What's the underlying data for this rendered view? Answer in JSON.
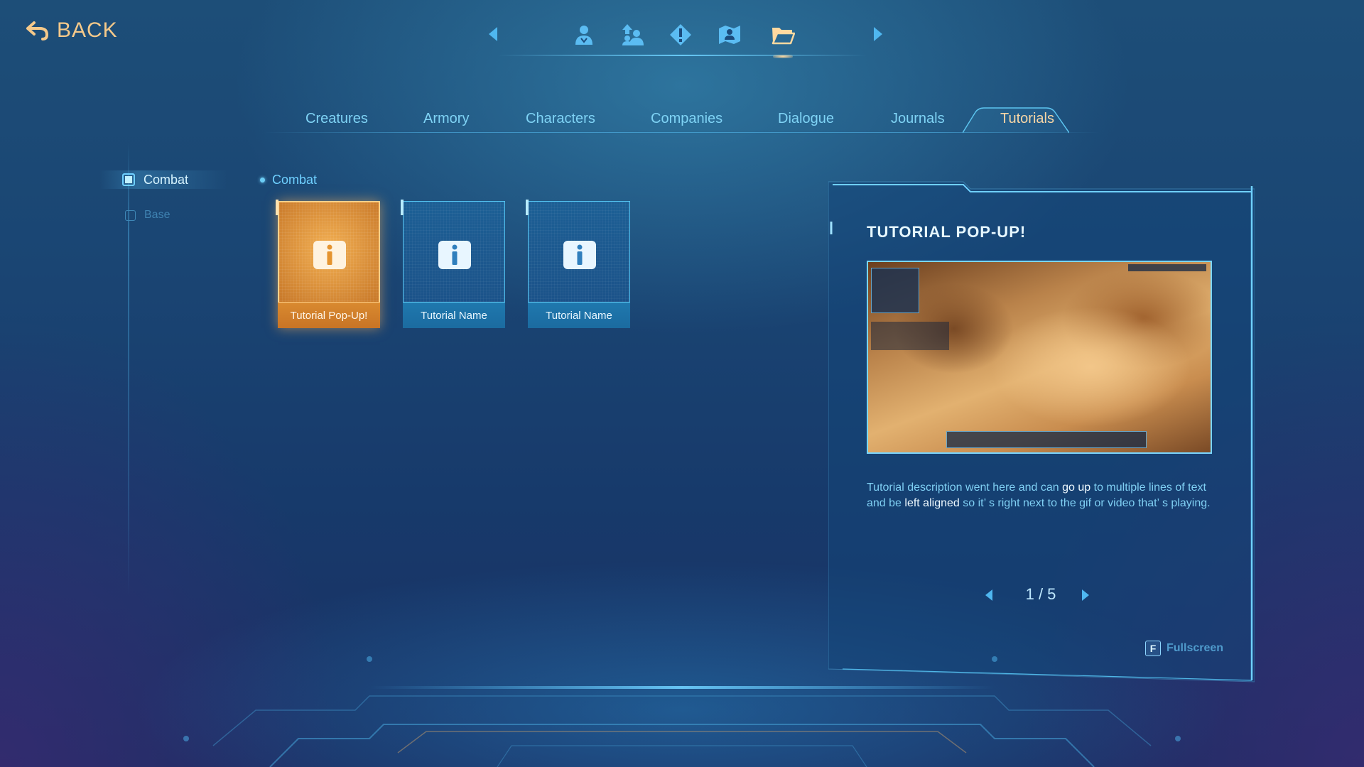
{
  "top_bar": {
    "back_label": "BACK",
    "nav_icons": [
      {
        "name": "character-icon",
        "active": false
      },
      {
        "name": "party-icon",
        "active": false
      },
      {
        "name": "alert-icon",
        "active": false
      },
      {
        "name": "map-icon",
        "active": false
      },
      {
        "name": "folder-icon",
        "active": true
      }
    ]
  },
  "tabs": [
    {
      "label": "Creatures",
      "active": false
    },
    {
      "label": "Armory",
      "active": false
    },
    {
      "label": "Characters",
      "active": false
    },
    {
      "label": "Companies",
      "active": false
    },
    {
      "label": "Dialogue",
      "active": false
    },
    {
      "label": "Journals",
      "active": false
    },
    {
      "label": "Tutorials",
      "active": true
    }
  ],
  "sidebar": {
    "items": [
      {
        "label": "Combat",
        "active": true
      },
      {
        "label": "Base",
        "active": false
      }
    ]
  },
  "category": {
    "label": "Combat"
  },
  "cards": [
    {
      "label": "Tutorial Pop-Up!",
      "selected": true
    },
    {
      "label": "Tutorial Name",
      "selected": false
    },
    {
      "label": "Tutorial Name",
      "selected": false
    }
  ],
  "detail": {
    "title": "TUTORIAL POP-UP!",
    "image_icon": "gameplay-screenshot",
    "description_parts": [
      {
        "text": "Tutorial description went here and can ",
        "highlight": false
      },
      {
        "text": "go up",
        "highlight": true
      },
      {
        "text": " to multiple lines of text and be ",
        "highlight": false
      },
      {
        "text": "left aligned",
        "highlight": true
      },
      {
        "text": " so it’ s right next to the gif or video that’ s playing.",
        "highlight": false
      }
    ],
    "pager": "1 / 5",
    "fullscreen_key": "F",
    "fullscreen_label": "Fullscreen"
  },
  "colors": {
    "accent_cyan": "#6fd0ff",
    "accent_gold": "#f5c98a",
    "selected_card": "#e0913a"
  }
}
